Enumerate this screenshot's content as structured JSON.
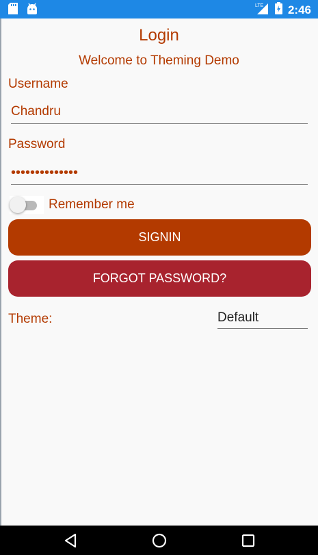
{
  "status_bar": {
    "left_icons": [
      "sd-card-icon",
      "android-icon"
    ],
    "network_label": "LTE",
    "time": "2:46",
    "color": "#1e88e5"
  },
  "login": {
    "title": "Login",
    "subtitle": "Welcome to Theming Demo",
    "username_label": "Username",
    "username_value": "Chandru",
    "password_label": "Password",
    "password_value": "••••••••••••••",
    "remember_label": "Remember me",
    "signin_label": "SIGNIN",
    "forgot_label": "FORGOT PASSWORD?",
    "theme_label": "Theme:",
    "theme_value": "Default"
  },
  "colors": {
    "accent": "#b33a00",
    "forgot_button": "#a8232e",
    "background": "#f9f9f9"
  },
  "nav_bar": {
    "buttons": [
      "back-icon",
      "home-icon",
      "recents-icon"
    ]
  }
}
